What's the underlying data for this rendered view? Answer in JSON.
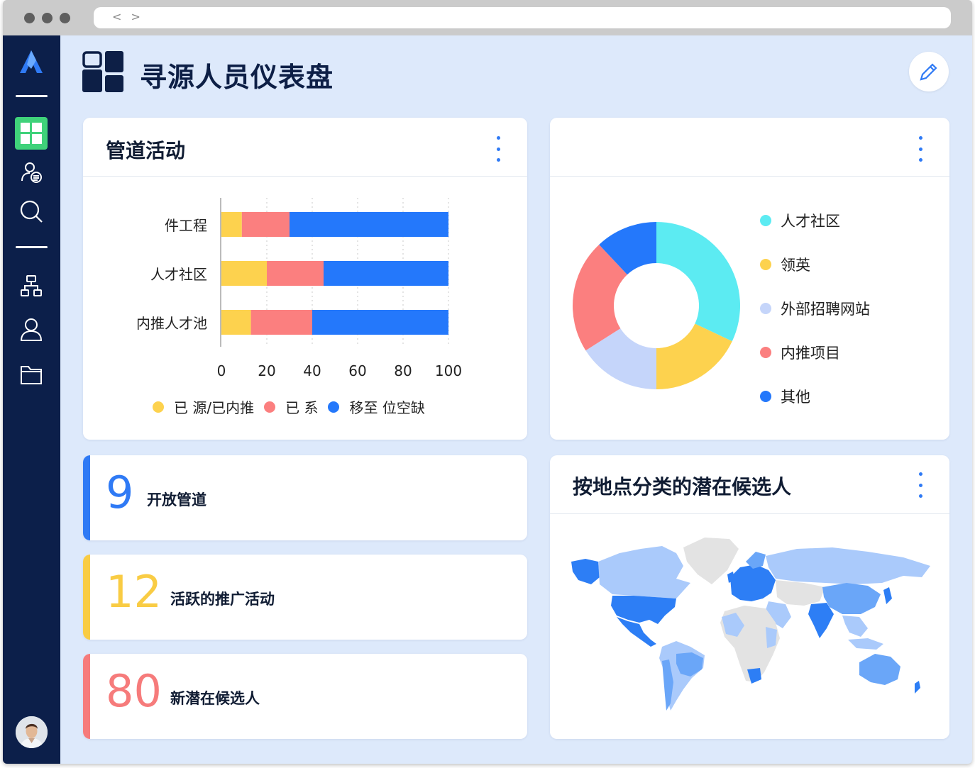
{
  "browser": {
    "nav": "< >"
  },
  "header": {
    "title": "寻源人员仪表盘"
  },
  "sidebar": {
    "icons": [
      "logo-icon",
      "dashboard-icon",
      "candidate-list-icon",
      "search-icon",
      "org-chart-icon",
      "user-icon",
      "folder-icon",
      "avatar"
    ]
  },
  "pipeline_card": {
    "title": "管道活动",
    "legend": [
      "已 源/已内推",
      "已 系",
      "移至 位空缺"
    ]
  },
  "donut_card": {
    "title": "",
    "legend": [
      "人才社区",
      "领英",
      "外部招聘网站",
      "内推项目",
      "其他"
    ]
  },
  "stats": [
    {
      "value": "9",
      "label": "开放管道",
      "color": "#2f7af5"
    },
    {
      "value": "12",
      "label": "活跃的推广活动",
      "color": "#f9cc44"
    },
    {
      "value": "80",
      "label": "新潜在候选人",
      "color": "#f67b7b"
    }
  ],
  "map_card": {
    "title": "按地点分类的潜在候选人"
  },
  "chart_data": [
    {
      "type": "bar",
      "stacked": true,
      "orientation": "horizontal",
      "categories": [
        "件工程",
        "人才社区",
        "内推人才池"
      ],
      "series": [
        {
          "name": "已 源/已内推",
          "values": [
            9,
            20,
            13
          ],
          "color": "#fdd24e"
        },
        {
          "name": "已 系",
          "values": [
            21,
            25,
            27
          ],
          "color": "#fb7f7f"
        },
        {
          "name": "移至 位空缺",
          "values": [
            70,
            55,
            60
          ],
          "color": "#2478fb"
        }
      ],
      "xticks": [
        "0",
        "20",
        "40",
        "60",
        "80",
        "100"
      ],
      "xlim": [
        0,
        100
      ],
      "grid": true,
      "legend_position": "bottom"
    },
    {
      "type": "pie",
      "donut": true,
      "labels": [
        "人才社区",
        "领英",
        "外部招聘网站",
        "内推项目",
        "其他"
      ],
      "values": [
        32,
        18,
        16,
        22,
        12
      ],
      "colors": [
        "#5cebf2",
        "#fdd24e",
        "#c5d5fa",
        "#fb7f7f",
        "#2478fb"
      ],
      "legend_position": "right"
    }
  ],
  "colors": {
    "sidebar": "#0c1f4a",
    "background": "#dde9fb",
    "accent": "#2f7af5",
    "active_icon": "#3fd27a"
  }
}
